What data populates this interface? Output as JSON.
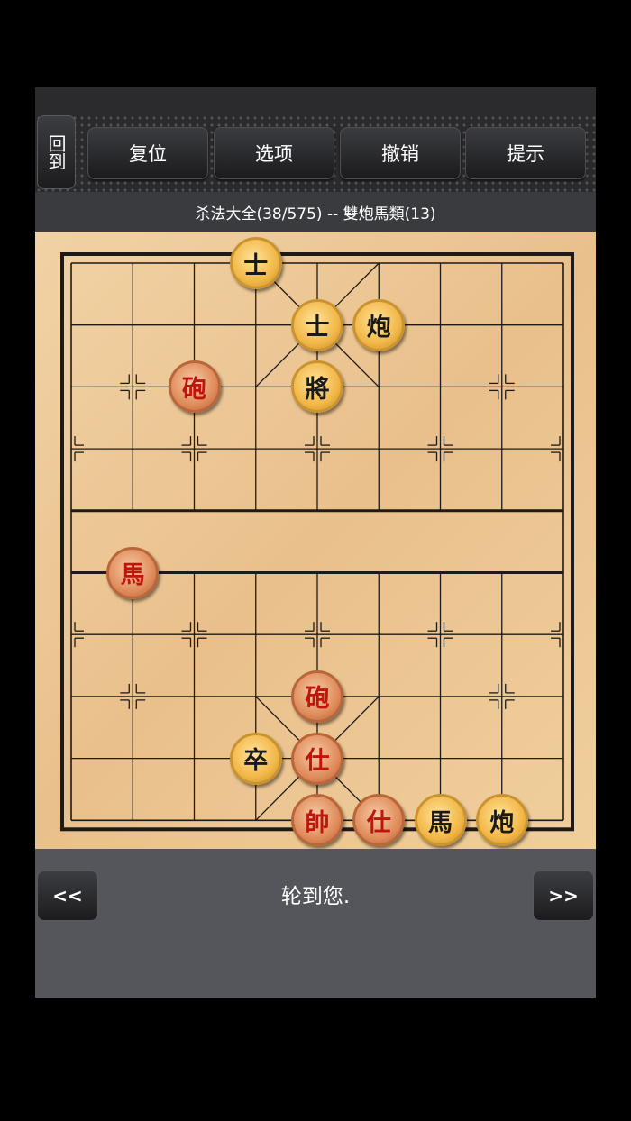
{
  "toolbar": {
    "back_label": "回到",
    "buttons": [
      "复位",
      "选项",
      "撤销",
      "提示"
    ]
  },
  "puzzle_title": "杀法大全(38/575) -- 雙炮馬類(13)",
  "board": {
    "files": 9,
    "ranks": 10,
    "pieces": [
      {
        "file": 3,
        "rank": 0,
        "side": "black",
        "char": "士"
      },
      {
        "file": 4,
        "rank": 1,
        "side": "black",
        "char": "士"
      },
      {
        "file": 5,
        "rank": 1,
        "side": "black",
        "char": "炮"
      },
      {
        "file": 2,
        "rank": 2,
        "side": "red",
        "char": "砲"
      },
      {
        "file": 4,
        "rank": 2,
        "side": "black",
        "char": "將"
      },
      {
        "file": 1,
        "rank": 5,
        "side": "red",
        "char": "馬"
      },
      {
        "file": 4,
        "rank": 7,
        "side": "red",
        "char": "砲"
      },
      {
        "file": 3,
        "rank": 8,
        "side": "black",
        "char": "卒"
      },
      {
        "file": 4,
        "rank": 8,
        "side": "red",
        "char": "仕"
      },
      {
        "file": 4,
        "rank": 9,
        "side": "red",
        "char": "帥"
      },
      {
        "file": 5,
        "rank": 9,
        "side": "red",
        "char": "仕"
      },
      {
        "file": 6,
        "rank": 9,
        "side": "black",
        "char": "馬"
      },
      {
        "file": 7,
        "rank": 9,
        "side": "black",
        "char": "炮"
      }
    ]
  },
  "nav": {
    "prev_label": "<<",
    "next_label": ">>"
  },
  "status_text": "轮到您.",
  "colors": {
    "red_piece_text": "#c0150d",
    "black_piece_text": "#1a1a1a"
  }
}
